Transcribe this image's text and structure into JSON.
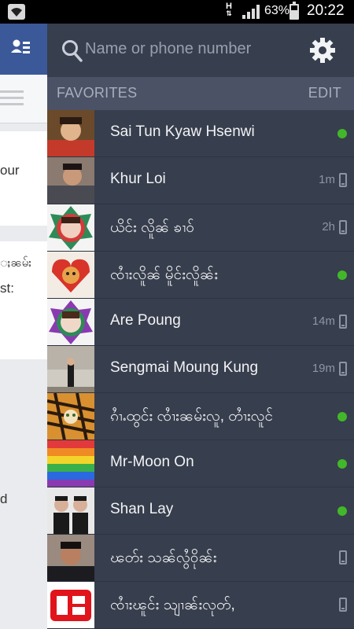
{
  "status_bar": {
    "network_type": "H",
    "battery_percent": "63%",
    "battery_level": 0.63,
    "time": "20:22",
    "icons": [
      "wifi-icon",
      "data-arrows-icon",
      "signal-bars-icon",
      "battery-icon"
    ]
  },
  "left_panel": {
    "fragments": [
      "our",
      "ႈၼမ်း",
      "st:",
      "d"
    ]
  },
  "search": {
    "placeholder": "Name or phone number",
    "icons": [
      "search-icon",
      "gear-icon"
    ]
  },
  "favorites": {
    "title": "FAVORITES",
    "edit_label": "EDIT",
    "contacts": [
      {
        "name": "Sai Tun Kyaw Hsenwi",
        "status": "online",
        "last_seen": ""
      },
      {
        "name": "Khur Loi",
        "status": "mobile",
        "last_seen": "1m"
      },
      {
        "name": "ယိင်း လိူၼ် ၶၢဝ်",
        "status": "mobile",
        "last_seen": "2h"
      },
      {
        "name": "ၸၢႆးလိူၼ် မိူင်းလိူၼ်း",
        "status": "online",
        "last_seen": ""
      },
      {
        "name": "Are Poung",
        "status": "mobile",
        "last_seen": "14m"
      },
      {
        "name": "Sengmai Moung Kung",
        "status": "mobile",
        "last_seen": "19m"
      },
      {
        "name": "ၵၢႆႉထွင်း ၸၢႆးၼမ်းလူ, တၢႆးလူင်",
        "status": "online",
        "last_seen": ""
      },
      {
        "name": "Mr-Moon On",
        "status": "online",
        "last_seen": ""
      },
      {
        "name": "Shan Lay",
        "status": "online",
        "last_seen": ""
      },
      {
        "name": "ၽတ်း သၼ်လွႆဝိုၼ်း",
        "status": "mobile",
        "last_seen": ""
      },
      {
        "name": "ၸၢႆးၽူင်း သျၢၼ်းလုတ်,",
        "status": "mobile",
        "last_seen": ""
      }
    ]
  },
  "colors": {
    "panel": "#373e4d",
    "header": "#4b5266",
    "online": "#42b72a",
    "facebook_blue": "#3b5998"
  }
}
